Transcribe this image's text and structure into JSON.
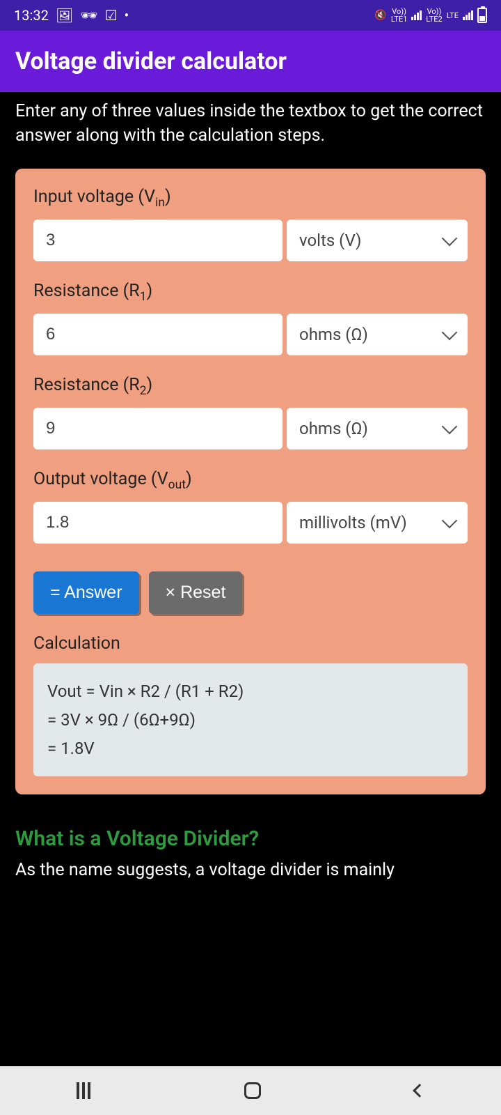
{
  "status": {
    "time": "13:32",
    "lte1_vo": "Vo))",
    "lte1": "LTE1",
    "lte2_vo": "Vo))",
    "lte2": "LTE",
    "lte2b": "LTE2"
  },
  "header": {
    "title": "Voltage divider calculator"
  },
  "intro": "Enter any of three values inside the textbox to get the correct answer along with the calculation steps.",
  "fields": {
    "vin": {
      "label_pre": "Input voltage (V",
      "label_sub": "in",
      "label_post": ")",
      "value": "3",
      "unit": "volts (V)"
    },
    "r1": {
      "label_pre": "Resistance (R",
      "label_sub": "1",
      "label_post": ")",
      "value": "6",
      "unit": "ohms (Ω)"
    },
    "r2": {
      "label_pre": "Resistance (R",
      "label_sub": "2",
      "label_post": ")",
      "value": "9",
      "unit": "ohms (Ω)"
    },
    "vout": {
      "label_pre": "Output voltage (V",
      "label_sub": "out",
      "label_post": ")",
      "value": "1.8",
      "unit": "millivolts (mV)"
    }
  },
  "buttons": {
    "answer": "= Answer",
    "reset": "× Reset"
  },
  "calc": {
    "label": "Calculation",
    "line1": "Vout = Vin × R2 / (R1 + R2)",
    "line2": "= 3V × 9Ω / (6Ω+9Ω)",
    "line3": "= 1.8V"
  },
  "section": {
    "heading": "What is a Voltage Divider?",
    "text": "As the name suggests, a voltage divider is mainly"
  }
}
